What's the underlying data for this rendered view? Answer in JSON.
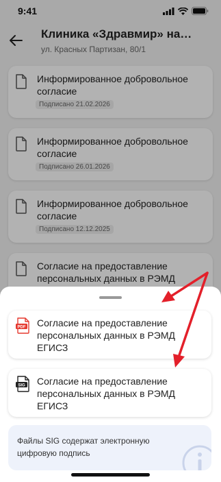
{
  "status_bar": {
    "time": "9:41"
  },
  "header": {
    "title": "Клиника «Здравмир» на…",
    "subtitle": "ул. Красных Партизан, 80/1"
  },
  "documents": [
    {
      "title": "Информированное добровольное согласие",
      "status": "Подписано 21.02.2026"
    },
    {
      "title": "Информированное добровольное согласие",
      "status": "Подписано 26.01.2026"
    },
    {
      "title": "Информированное добровольное согласие",
      "status": "Подписано 12.12.2025"
    },
    {
      "title": "Согласие на предоставление персональных данных в РЭМД ЕГИСЗ",
      "status": ""
    }
  ],
  "sheet": {
    "options": [
      {
        "label": "Согласие на предоставление персональных данных в РЭМД ЕГИСЗ",
        "icon": "pdf-file-icon",
        "icon_text": "PDF"
      },
      {
        "label": "Согласие на предоставление персональных данных в РЭМД ЕГИСЗ",
        "icon": "sig-file-icon",
        "icon_text": "SIG"
      }
    ],
    "info": "Файлы SIG содержат электронную цифровую подпись"
  },
  "colors": {
    "annotation_arrow": "#e3202a",
    "pdf_red": "#e5392f",
    "info_bg": "#eef2fb"
  }
}
